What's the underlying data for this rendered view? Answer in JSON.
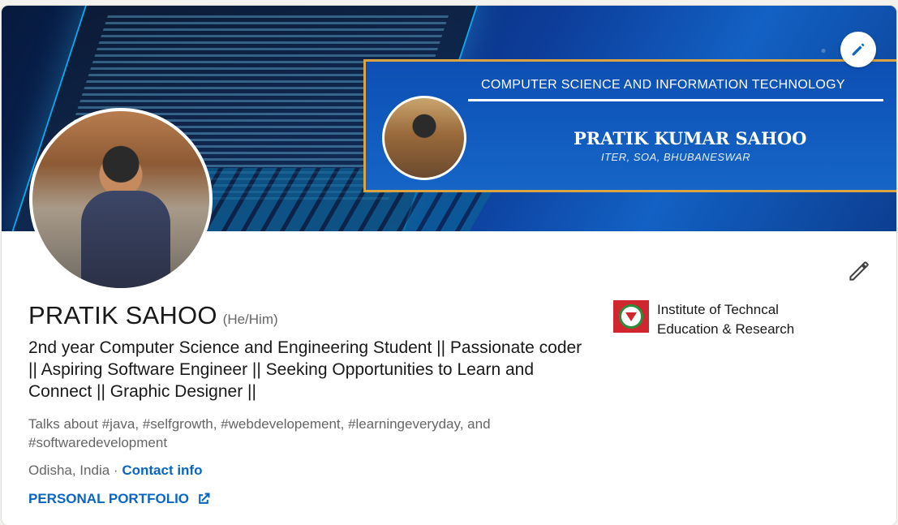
{
  "banner": {
    "title": "COMPUTER SCIENCE AND INFORMATION TECHNOLOGY",
    "name": "PRATIK KUMAR SAHOO",
    "subtitle": "ITER, SOA, BHUBANESWAR"
  },
  "profile": {
    "name": "PRATIK SAHOO",
    "pronouns": "(He/Him)",
    "headline": "2nd year Computer Science and Engineering Student || Passionate coder || Aspiring Software Engineer || Seeking Opportunities to Learn and Connect || Graphic Designer ||",
    "talks_about": "Talks about #java, #selfgrowth, #webdevelopement, #learningeveryday, and #softwaredevelopment",
    "location": "Odisha, India",
    "separator": "·",
    "contact_label": "Contact info",
    "portfolio_label": "PERSONAL PORTFOLIO"
  },
  "education": {
    "school_name": "Institute of Techncal Education & Research"
  },
  "colors": {
    "link": "#0a66c2",
    "text": "#191919",
    "muted": "#666666"
  },
  "icons": {
    "banner_edit": "pencil-icon",
    "profile_edit": "pencil-icon",
    "external_link": "external-link-icon"
  }
}
